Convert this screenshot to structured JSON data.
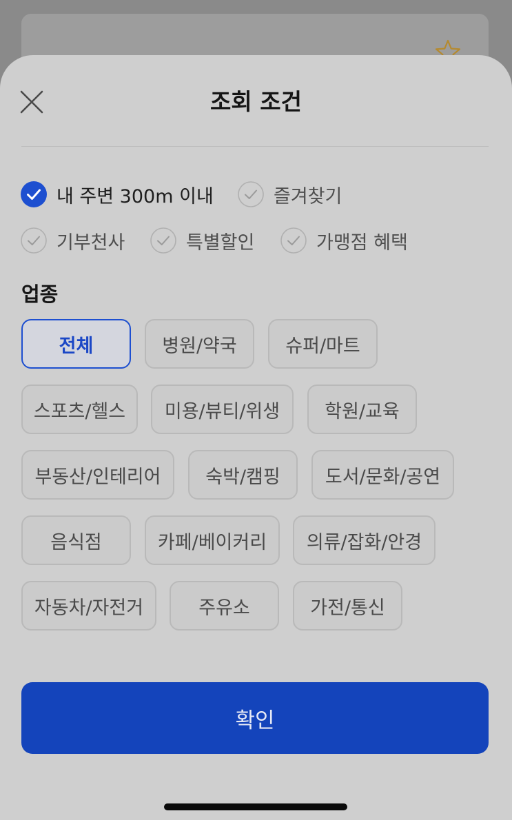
{
  "header": {
    "title": "조회 조건",
    "close_icon": "close-icon"
  },
  "filters": [
    {
      "label": "내 주변 300m 이내",
      "checked": true
    },
    {
      "label": "즐겨찾기",
      "checked": false
    },
    {
      "label": "기부천사",
      "checked": false
    },
    {
      "label": "특별할인",
      "checked": false
    },
    {
      "label": "가맹점 혜택",
      "checked": false
    }
  ],
  "category": {
    "label": "업종",
    "selected": "전체",
    "items": [
      "전체",
      "병원/약국",
      "슈퍼/마트",
      "스포츠/헬스",
      "미용/뷰티/위생",
      "학원/교육",
      "부동산/인테리어",
      "숙박/캠핑",
      "도서/문화/공연",
      "음식점",
      "카페/베이커리",
      "의류/잡화/안경",
      "자동차/자전거",
      "주유소",
      "가전/통신"
    ]
  },
  "confirm_label": "확인",
  "colors": {
    "accent": "#1444bb",
    "checked_fill": "#1d4fd0",
    "sheet_bg": "#cfcfcf",
    "star_outline": "#b58a2e"
  }
}
